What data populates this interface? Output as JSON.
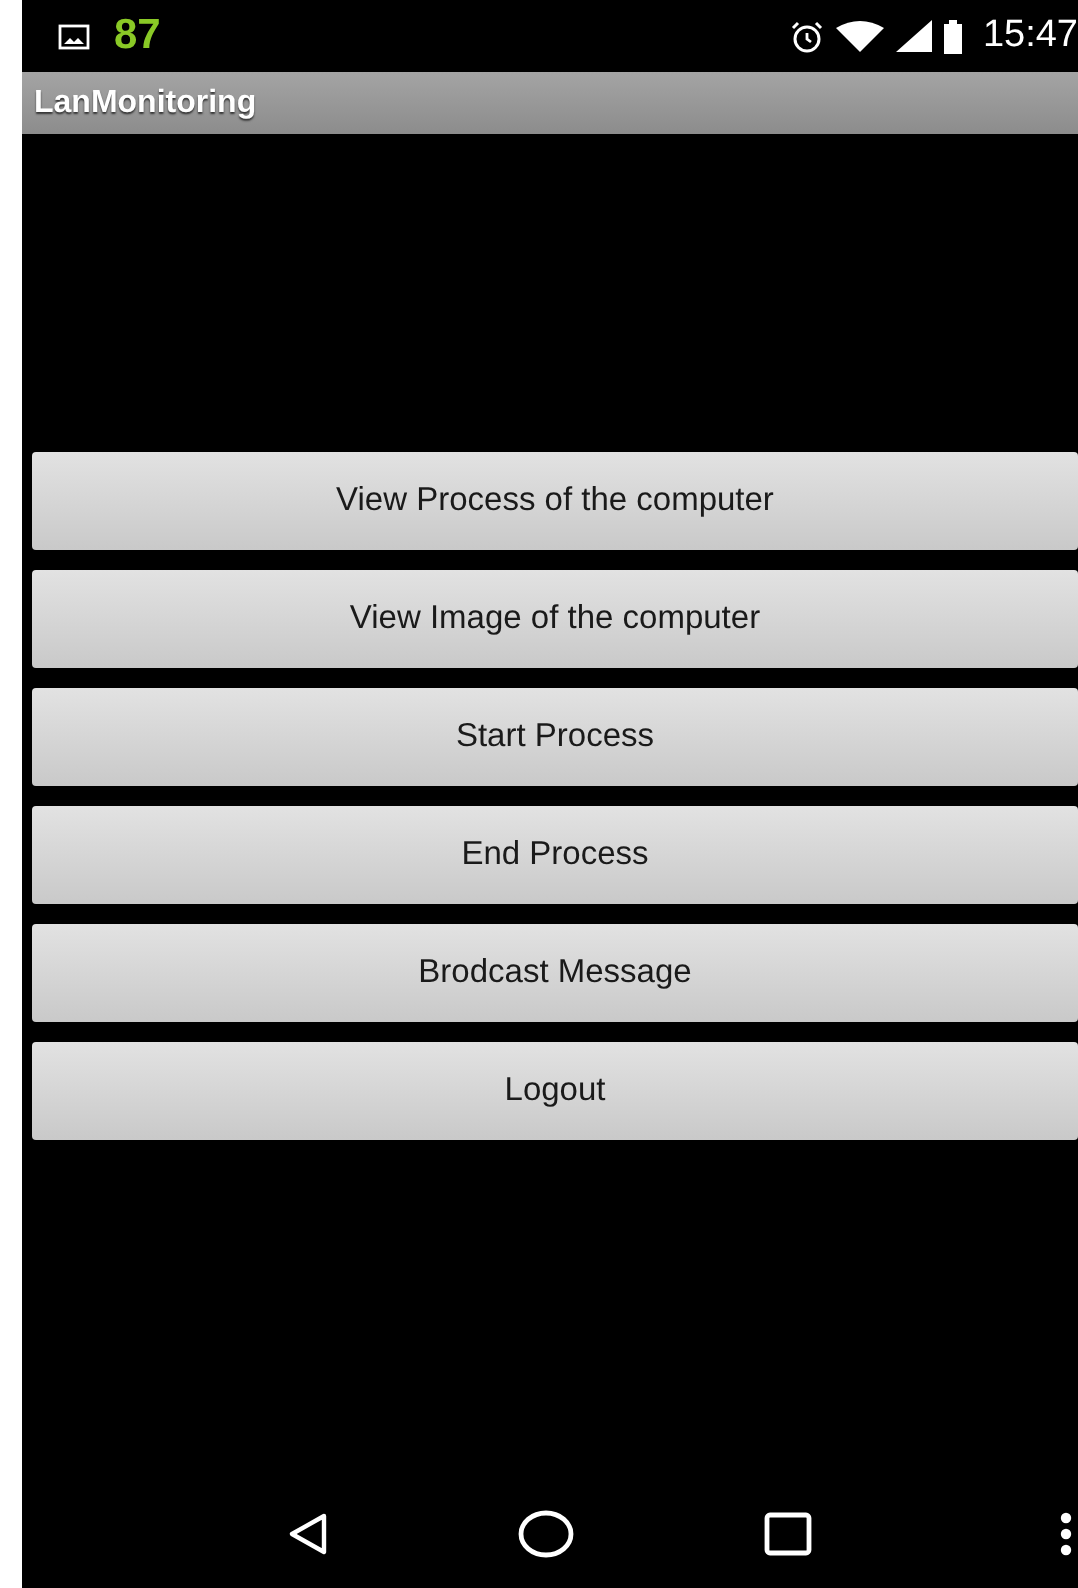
{
  "status_bar": {
    "notification_count": "87",
    "time": "15:47"
  },
  "app_bar": {
    "title": "LanMonitoring"
  },
  "buttons": [
    "View Process of the computer",
    "View Image of the computer",
    "Start Process",
    "End Process",
    "Brodcast Message",
    "Logout"
  ]
}
